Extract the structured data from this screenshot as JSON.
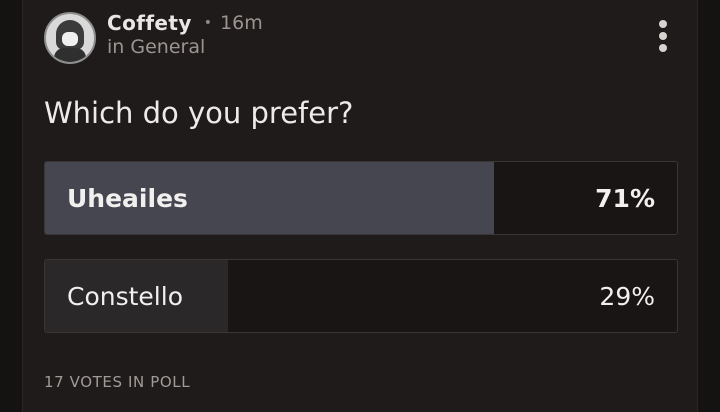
{
  "post": {
    "author": "Coffety",
    "separator": "•",
    "time": "16m",
    "channel": "in General",
    "question": "Which do you prefer?"
  },
  "poll": {
    "options": [
      {
        "label": "Uheailes",
        "percent_label": "71%",
        "percent": 71,
        "fill_color": "#454650",
        "winner": true
      },
      {
        "label": "Constello",
        "percent_label": "29%",
        "percent": 29,
        "fill_color": "#2b2829",
        "winner": false
      }
    ],
    "votes_label": "17 VOTES IN POLL"
  },
  "icons": {
    "menu": "more-vertical-icon",
    "avatar": "user-avatar"
  },
  "colors": {
    "card_background": "#1e1b1a",
    "winner_fill": "#454650",
    "other_fill": "#2b2829"
  }
}
